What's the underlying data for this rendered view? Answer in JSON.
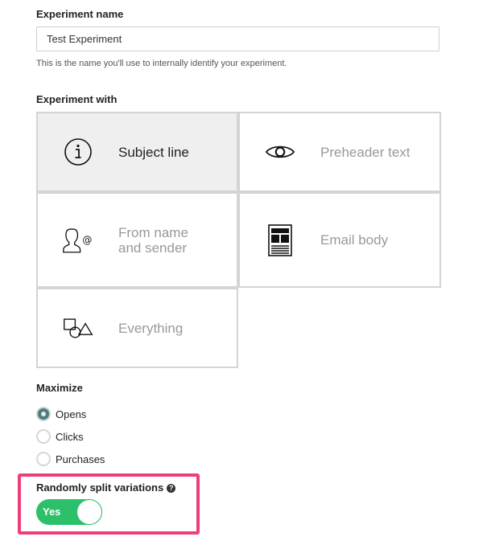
{
  "experiment_name": {
    "label": "Experiment name",
    "value": "Test Experiment",
    "helper": "This is the name you'll use to internally identify your experiment."
  },
  "experiment_with": {
    "label": "Experiment with",
    "options": [
      {
        "label": "Subject line",
        "icon": "info-circle-icon",
        "selected": true
      },
      {
        "label": "Preheader text",
        "icon": "eye-icon",
        "selected": false
      },
      {
        "label": "From name\nand sender",
        "icon": "person-at-icon",
        "selected": false
      },
      {
        "label": "Email body",
        "icon": "newsletter-layout-icon",
        "selected": false
      },
      {
        "label": "Everything",
        "icon": "shapes-icon",
        "selected": false
      }
    ]
  },
  "maximize": {
    "label": "Maximize",
    "options": [
      {
        "label": "Opens",
        "checked": true
      },
      {
        "label": "Clicks",
        "checked": false
      },
      {
        "label": "Purchases",
        "checked": false
      }
    ]
  },
  "split": {
    "label": "Randomly split variations",
    "help_icon": "question-circle-icon",
    "toggle_text": "Yes",
    "enabled": true
  },
  "colors": {
    "toggle_on": "#2cc06b",
    "highlight": "#ef3f7a",
    "radio_checked": "#4e7b7b",
    "selected_card_bg": "#efefef"
  }
}
